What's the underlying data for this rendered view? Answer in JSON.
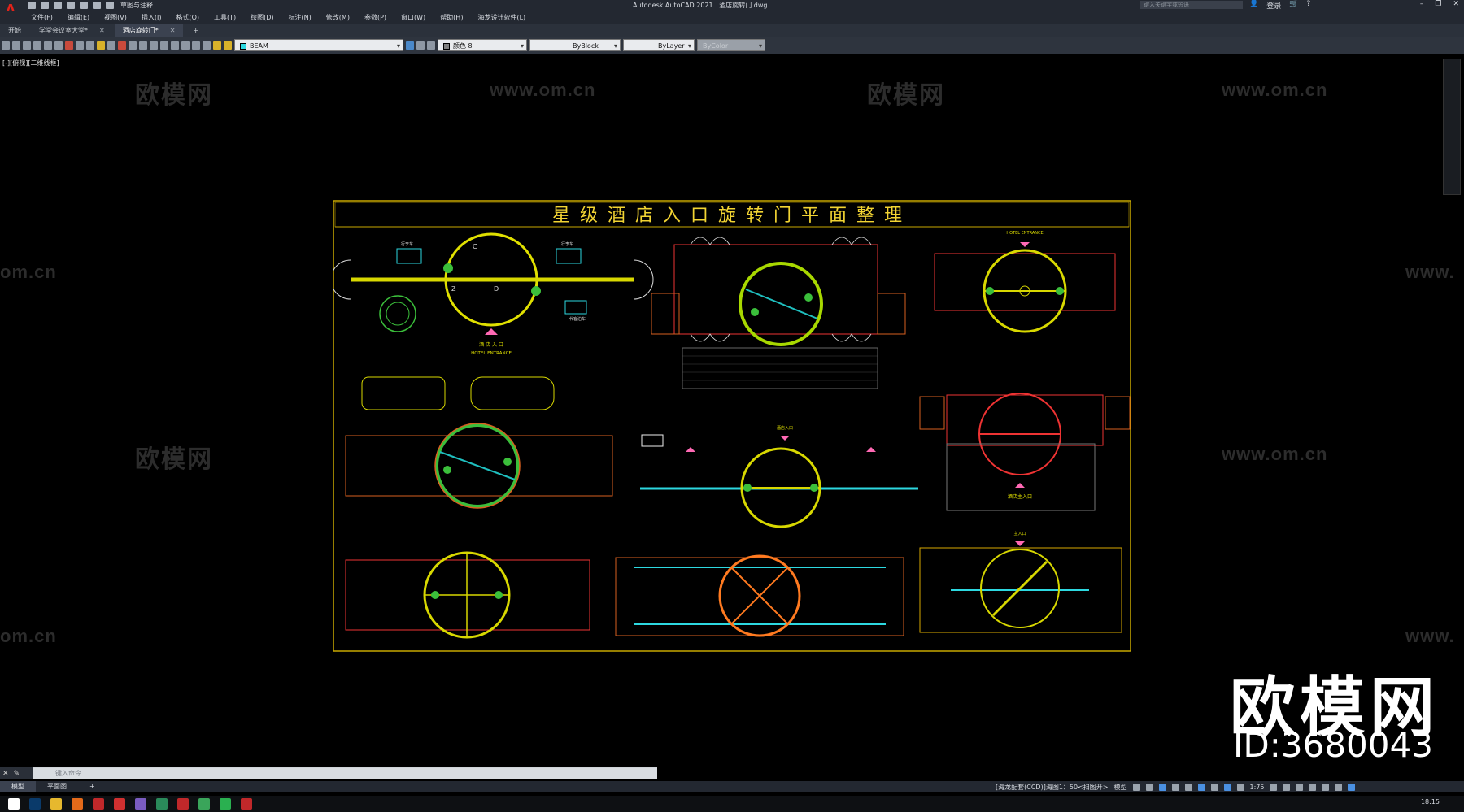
{
  "app": {
    "title": "Autodesk AutoCAD 2021",
    "document": "酒店旋转门.dwg",
    "workspace": "草图与注释",
    "search_placeholder": "键入关键字或短语",
    "login": "登录"
  },
  "menu": [
    "文件(F)",
    "编辑(E)",
    "视图(V)",
    "插入(I)",
    "格式(O)",
    "工具(T)",
    "绘图(D)",
    "标注(N)",
    "修改(M)",
    "参数(P)",
    "窗口(W)",
    "帮助(H)",
    "海龙设计软件(L)"
  ],
  "tabs": [
    {
      "label": "开始",
      "closable": false,
      "active": false
    },
    {
      "label": "学堂会议室大堂*",
      "closable": true,
      "active": false
    },
    {
      "label": "酒店旋转门*",
      "closable": true,
      "active": true
    }
  ],
  "toolbar": {
    "layer": "BEAM",
    "color": "颜色 8",
    "linetype": "ByBlock",
    "lineweight": "ByLayer",
    "plotstyle": "ByColor"
  },
  "view_label": "[-][俯视][二维线框]",
  "watermarks": {
    "brand": "欧模网",
    "url": "www.om.cn",
    "url_partial": "om.cn",
    "url_edge": "www."
  },
  "drawing": {
    "title": "星级酒店入口旋转门平面整理",
    "labels": {
      "hotel_entrance_cn": "酒 店 入 口",
      "hotel_entrance_en": "HOTEL ENTRANCE",
      "hotel_entrance_en2": "HOTEL ENTRANCE",
      "main_entrance": "酒店主入口",
      "entrance_small": "酒店入口",
      "entrance_small2": "主入口",
      "label_c": "C",
      "label_d": "D",
      "label_z": "Z",
      "sign_left": "行李车",
      "sign_right": "行李车",
      "sign_mid": "代客泊车"
    }
  },
  "big_watermark": {
    "brand": "欧模网",
    "id": "ID:3680043"
  },
  "command": {
    "placeholder": "键入命令"
  },
  "layout_tabs": [
    "模型",
    "平面图"
  ],
  "status": {
    "text": "[海龙配套(CCD)]海图1：50<扫图开>",
    "model": "模型",
    "scale": "1:75"
  },
  "clock": "18:15",
  "colors": {
    "accent": "#e2231a",
    "frame": "#c8a800"
  }
}
